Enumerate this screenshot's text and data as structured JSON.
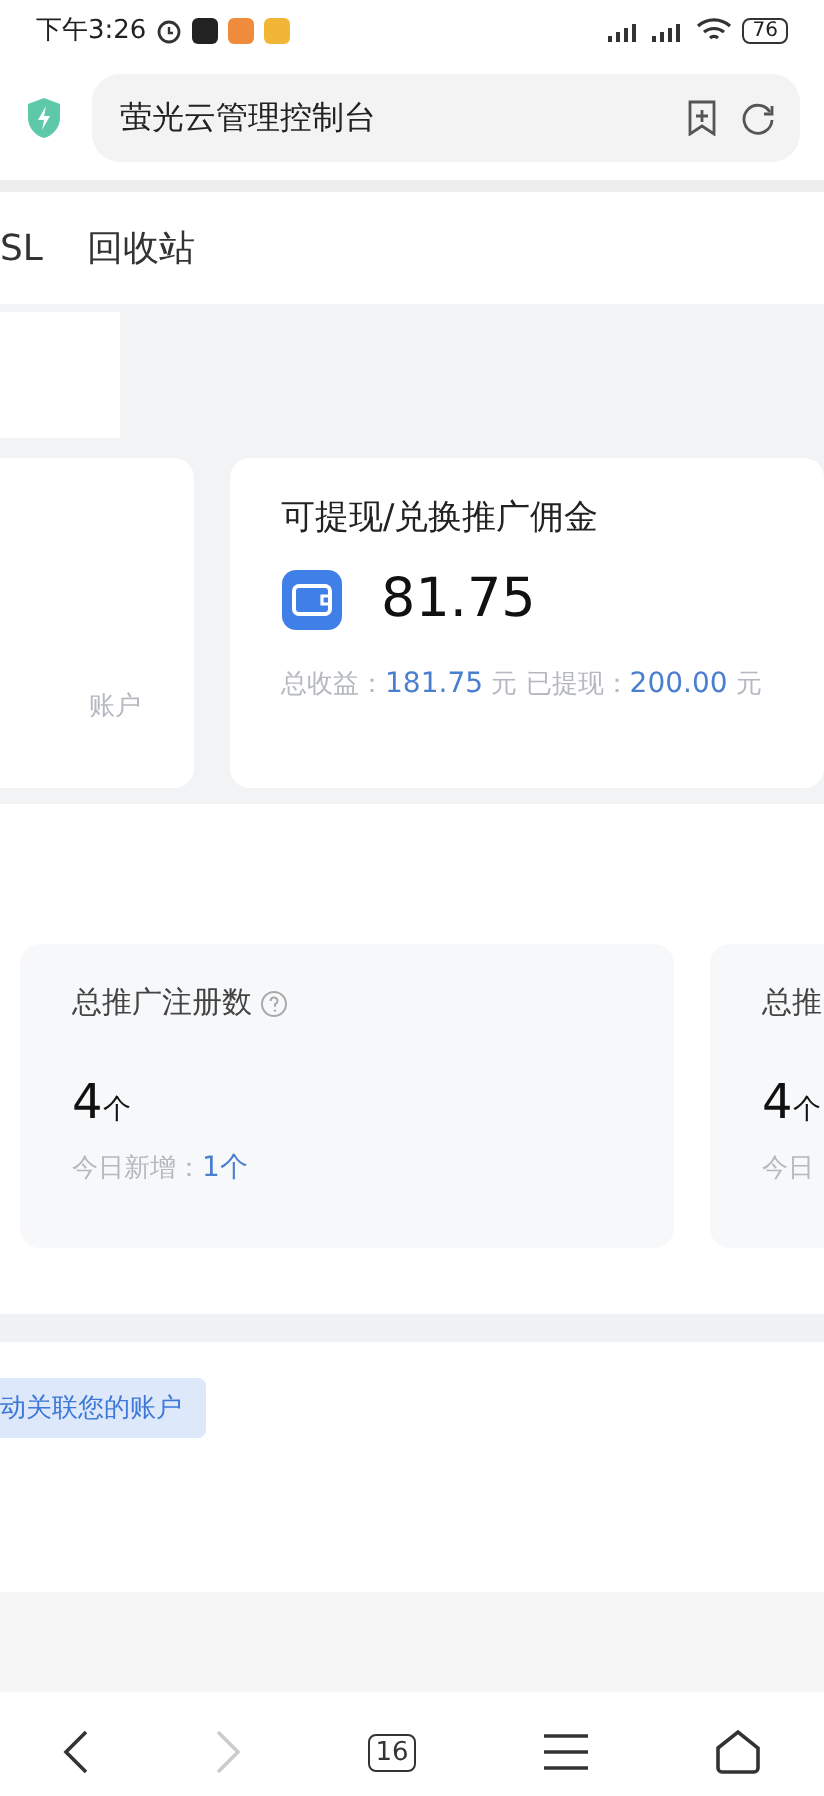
{
  "status_bar": {
    "time": "下午3:26",
    "battery": "76"
  },
  "address_bar": {
    "title": "萤光云管理控制台"
  },
  "tabs": [
    {
      "label": "SL",
      "selected": false
    },
    {
      "label": "回收站",
      "selected": false
    }
  ],
  "commission_cards": [
    {
      "footer": [
        {
          "kind": "label",
          "text": "账户"
        }
      ]
    },
    {
      "title": "可提现/兑换推广佣金",
      "amount": "81.75",
      "footer": [
        {
          "kind": "label",
          "text": "总收益："
        },
        {
          "kind": "value",
          "text": "181.75"
        },
        {
          "kind": "label",
          "text": " 元 已提现："
        },
        {
          "kind": "value",
          "text": "200.00"
        },
        {
          "kind": "label",
          "text": " 元"
        }
      ]
    }
  ],
  "stat_cards": [
    {
      "title": "总推广注册数",
      "help": true,
      "value": "4",
      "unit": "个",
      "today_label": "今日新增：",
      "today_value": "1个"
    },
    {
      "title": "总推",
      "help": false,
      "value": "4",
      "unit": "个",
      "today_label": "今日"
    }
  ],
  "notice_tag": "动关联您的账户",
  "bottom_nav": [
    {
      "kind": "back",
      "disabled": false
    },
    {
      "kind": "forward",
      "disabled": true
    },
    {
      "kind": "tabs",
      "count": "16",
      "disabled": false
    },
    {
      "kind": "menu",
      "disabled": false
    },
    {
      "kind": "home",
      "disabled": false
    }
  ]
}
